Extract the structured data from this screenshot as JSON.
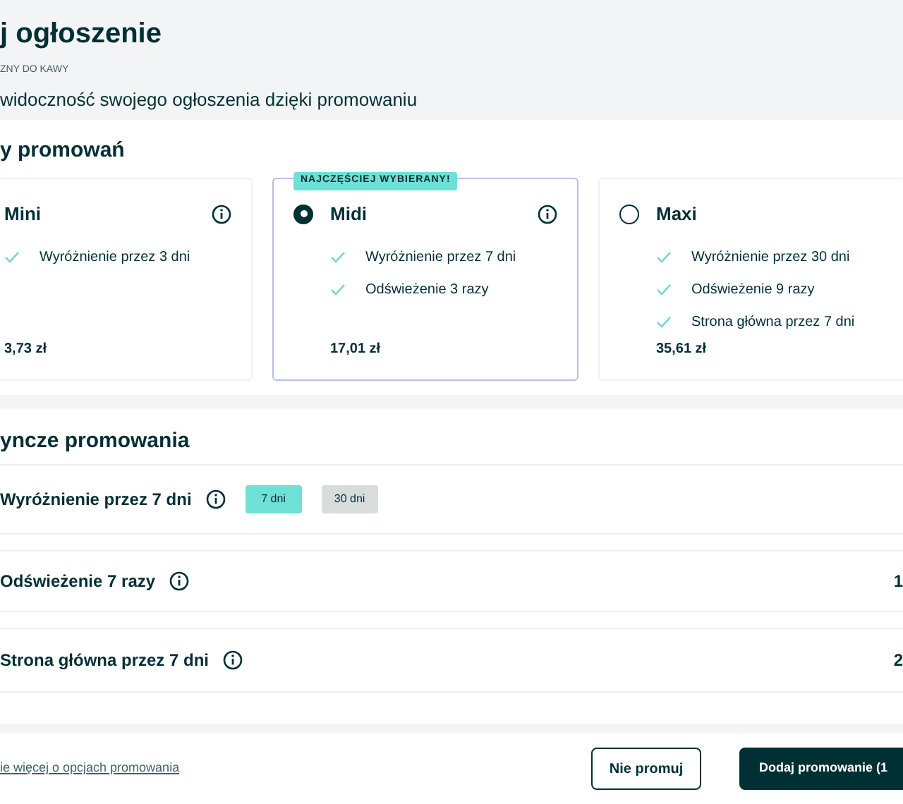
{
  "header": {
    "title": "j ogłoszenie",
    "category": "ZNY DO KAWY",
    "description": "widoczność swojego ogłoszenia dzięki promowaniu"
  },
  "plans_section": {
    "heading": "y promowań",
    "plans": [
      {
        "name": "Mini",
        "selected": false,
        "info_icon": true,
        "features": [
          "Wyróżnienie przez 3 dni"
        ],
        "price": "3,73 zł"
      },
      {
        "name": "Midi",
        "selected": true,
        "badge": "NAJCZĘŚCIEJ WYBIERANY!",
        "info_icon": true,
        "features": [
          "Wyróżnienie przez 7 dni",
          "Odświeżenie 3 razy"
        ],
        "price": "17,01 zł"
      },
      {
        "name": "Maxi",
        "selected": false,
        "info_icon": false,
        "features": [
          "Wyróżnienie przez 30 dni",
          "Odświeżenie 9 razy",
          "Strona główna przez 7 dni"
        ],
        "price": "35,61 zł"
      }
    ]
  },
  "options_section": {
    "heading": "yncze promowania",
    "options": [
      {
        "label": "Wyróżnienie przez 7 dni",
        "chips": [
          {
            "label": "7 dni",
            "selected": true
          },
          {
            "label": "30 dni",
            "selected": false
          }
        ]
      },
      {
        "label": "Odświeżenie 7 razy",
        "price": "1"
      },
      {
        "label": "Strona główna przez 7 dni",
        "price": "2"
      }
    ]
  },
  "footer": {
    "link": "ie więcej o opcjach promowania",
    "secondary_button": "Nie promuj",
    "primary_button": "Dodaj promowanie (1"
  }
}
